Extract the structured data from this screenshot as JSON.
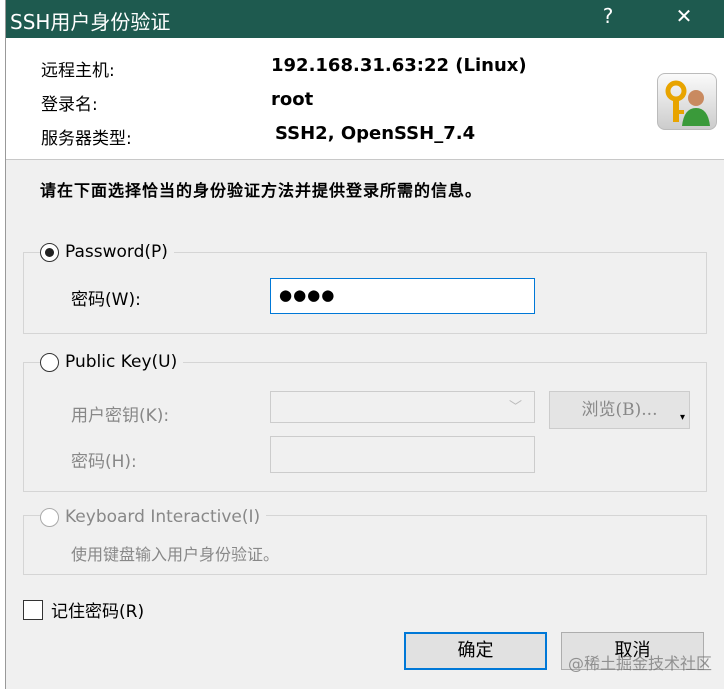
{
  "window": {
    "title": "SSH用户身份验证",
    "help": "?",
    "close": "✕"
  },
  "info": {
    "remote_host_label": "远程主机:",
    "remote_host": "192.168.31.63:22 (Linux)",
    "login_label": "登录名:",
    "login": "root",
    "server_type_label": "服务器类型:",
    "server_type": "SSH2, OpenSSH_7.4"
  },
  "instruction": "请在下面选择恰当的身份验证方法并提供登录所需的信息。",
  "password": {
    "label": "Password(P)",
    "selected": true,
    "field_label": "密码(W):",
    "value": "●●●●"
  },
  "publickey": {
    "label": "Public Key(U)",
    "selected": false,
    "key_label": "用户密钥(K):",
    "browse": "浏览(B)...",
    "pass_label": "密码(H):"
  },
  "keyboard": {
    "label": "Keyboard Interactive(I)",
    "desc": "使用键盘输入用户身份验证。"
  },
  "remember": {
    "label": "记住密码(R)",
    "checked": false
  },
  "buttons": {
    "ok": "确定",
    "cancel": "取消"
  },
  "watermark": "@稀土掘金技术社区"
}
